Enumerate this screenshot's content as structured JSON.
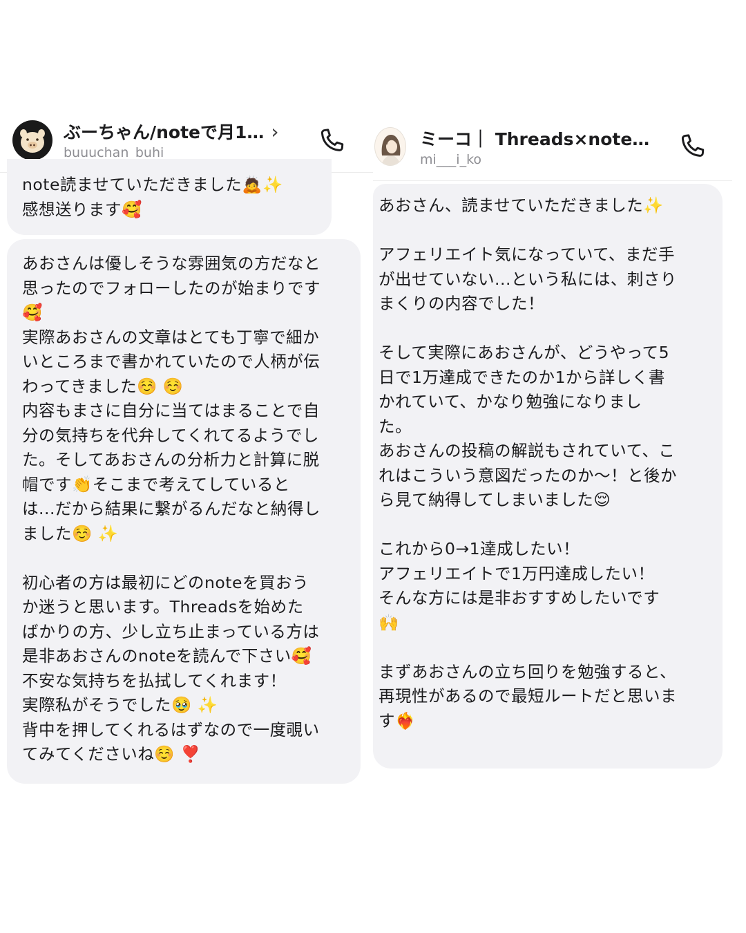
{
  "left_chat": {
    "header": {
      "name": "ぶーちゃん/noteで月1…",
      "chevron": "›",
      "handle": "buuuchan_buhi",
      "avatar_icon": "pig-avatar-icon",
      "phone_icon": "phone-icon"
    },
    "messages": [
      "note読ませていただきました🙇✨\n感想送ります🥰",
      "あおさんは優しそうな雰囲気の方だなと\n思ったのでフォローしたのが始まりです\n🥰\n実際あおさんの文章はとても丁寧で細か\nいところまで書かれていたので人柄が伝\nわってきました☺️ ☺️\n内容もまさに自分に当てはまることで自\n分の気持ちを代弁してくれてるようでし\nた。そしてあおさんの分析力と計算に脱\n帽です👏そこまで考えてしていると\nは...だから結果に繋がるんだなと納得し\nました☺️ ✨\n\n初心者の方は最初にどのnoteを買おう\nか迷うと思います。Threadsを始めた\nばかりの方、少し立ち止まっている方は\n是非あおさんのnoteを読んで下さい🥰\n不安な気持ちを払拭してくれます！\n実際私がそうでした🥹 ✨\n背中を押してくれるはずなので一度覗い\nてみてくださいね☺️ ❣️"
    ]
  },
  "right_chat": {
    "header": {
      "name": "ミーコ｜ Threads×note…",
      "handle": "mi___i_ko",
      "avatar_icon": "woman-avatar-icon",
      "phone_icon": "phone-icon"
    },
    "messages": [
      "あおさん、読ませていただきました✨\n\nアフェリエイト気になっていて、まだ手\nが出せていない...という私には、刺さり\nまくりの内容でした！\n\nそして実際にあおさんが、どうやって5\n日で1万達成できたのか1から詳しく書\nかれていて、かなり勉強になりまし\nた。\nあおさんの投稿の解説もされていて、こ\nれはこういう意図だったのか〜！と後か\nら見て納得してしまいました😌\n\nこれから0→1達成したい！\nアフェリエイトで1万円達成したい！\nそんな方には是非おすすめしたいです\n🙌\n\nまずあおさんの立ち回りを勉強すると、\n再現性があるので最短ルートだと思いま\nす❤️‍🔥"
    ]
  }
}
